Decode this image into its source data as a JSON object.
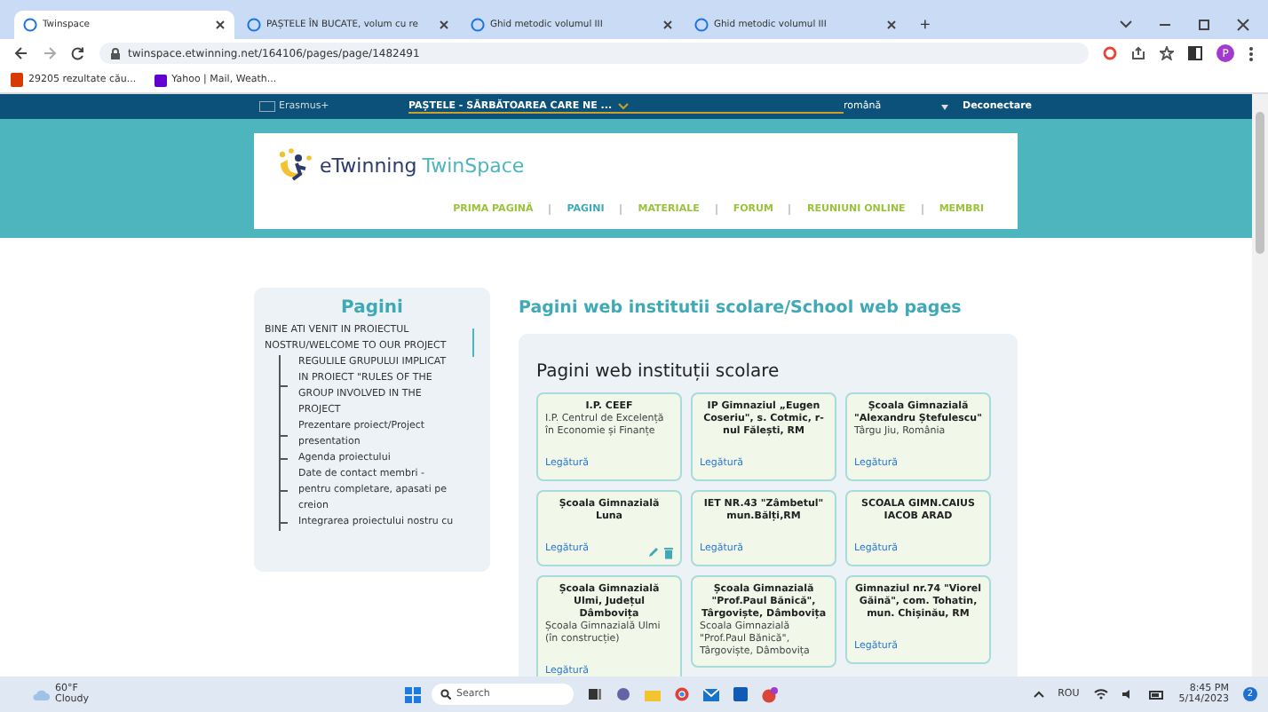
{
  "browser": {
    "tabs": [
      {
        "title": "Twinspace",
        "selected": true
      },
      {
        "title": "PAȘTELE ÎN BUCATE, volum cu re",
        "selected": false
      },
      {
        "title": "Ghid metodic volumul III",
        "selected": false
      },
      {
        "title": "Ghid metodic volumul III",
        "selected": false
      }
    ],
    "new_tab": "+",
    "url": "twinspace.etwinning.net/164106/pages/page/1482491",
    "profile": "P",
    "bookmarks": [
      "29205 rezultate cău...",
      "Yahoo | Mail, Weath..."
    ]
  },
  "topbar": {
    "brand": "Erasmus+",
    "project": "PAȘTELE - SĂRBĂTOAREA CARE NE ...",
    "language": "română",
    "logout": "Deconectare"
  },
  "logo": {
    "part1": "eTwinning",
    "part2": "TwinSpace"
  },
  "nav": [
    {
      "label": "PRIMA PAGINĂ",
      "selected": false
    },
    {
      "label": "PAGINI",
      "selected": true
    },
    {
      "label": "MATERIALE",
      "selected": false
    },
    {
      "label": "FORUM",
      "selected": false
    },
    {
      "label": "REUNIUNI ONLINE",
      "selected": false
    },
    {
      "label": "MEMBRI",
      "selected": false
    }
  ],
  "sidebar": {
    "title": "Pagini",
    "items": [
      {
        "label": "BINE ATI VENIT IN PROIECTUL NOSTRU/WELCOME TO OUR PROJECT",
        "children": [
          {
            "label": "REGULILE GRUPULUI IMPLICAT IN PROIECT \"RULES OF THE GROUP INVOLVED IN THE PROJECT"
          },
          {
            "label": "Prezentare proiect/Project presentation"
          },
          {
            "label": "Agenda proiectului"
          },
          {
            "label": "Date de contact membri - pentru completare, apasati pe creion"
          },
          {
            "label": "Integrarea proiectului nostru cu"
          }
        ]
      }
    ]
  },
  "page_title": "Pagini web institutii scolare/School web pages",
  "panel": {
    "title": "Pagini web instituții scolare",
    "cards": [
      {
        "title": "I.P. CEEF",
        "description": "I.P. Centrul de Excelență în Economie și Finanțe",
        "link": "Legătură",
        "editable": false
      },
      {
        "title": "IP Gimnaziul „Eugen Coseriu\", s. Cotmic, r-nul Fălești, RM",
        "link": "Legătură",
        "editable": false
      },
      {
        "title": "Școala Gimnazială \"Alexandru Ștefulescu\"",
        "description": "Târgu Jiu, România",
        "link": "Legătură",
        "editable": false
      },
      {
        "title": "Școala Gimnazială Luna",
        "link": "Legătură",
        "editable": true
      },
      {
        "title": "IET NR.43 \"Zâmbetul\" mun.Bălți,RM",
        "link": "Legătură",
        "editable": false
      },
      {
        "title": "SCOALA GIMN.CAIUS IACOB ARAD",
        "link": "Legătură",
        "editable": false
      },
      {
        "title": "Școala Gimnazială Ulmi, Județul Dâmbovița",
        "description": "Școala Gimnazială Ulmi (în construcție)",
        "link": "Legătură",
        "editable": false
      },
      {
        "title": "Școala Gimnazială \"Prof.Paul Bănică\", Târgoviște, Dâmbovița",
        "description": "Scoala Gimnazială \"Prof.Paul Bănică\", Târgoviște, Dâmbovița",
        "editable": false
      },
      {
        "title": "Gimnaziul nr.74 \"Viorel Găină\", com. Tohatin, mun. Chișinău, RM",
        "link": "Legătură",
        "editable": false
      }
    ]
  },
  "taskbar": {
    "temperature": "60°F",
    "weather": "Cloudy",
    "search_placeholder": "Search",
    "language": "ROU",
    "time": "8:45 PM",
    "date": "5/14/2023",
    "notifications": "2"
  }
}
